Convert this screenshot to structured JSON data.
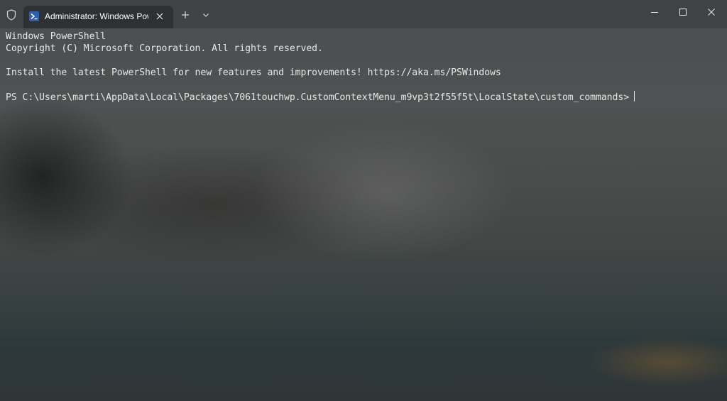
{
  "titlebar": {
    "tab_title": "Administrator: Windows PowerShell",
    "icons": {
      "shield": "shield-icon",
      "tab": "powershell-icon",
      "tab_close": "close-icon",
      "new_tab": "plus-icon",
      "dropdown": "chevron-down-icon",
      "minimize": "minimize-icon",
      "maximize": "maximize-icon",
      "close": "close-icon"
    }
  },
  "terminal": {
    "header_line1": "Windows PowerShell",
    "header_line2": "Copyright (C) Microsoft Corporation. All rights reserved.",
    "install_notice": "Install the latest PowerShell for new features and improvements! https://aka.ms/PSWindows",
    "prompt": "PS C:\\Users\\marti\\AppData\\Local\\Packages\\7061touchwp.CustomContextMenu_m9vp3t2f55f5t\\LocalState\\custom_commands>"
  },
  "colors": {
    "terminal_text": "#e6e6e6",
    "tab_background": "#2e3133",
    "titlebar_background": "#3e4244",
    "powershell_icon": "#2f5fae"
  }
}
